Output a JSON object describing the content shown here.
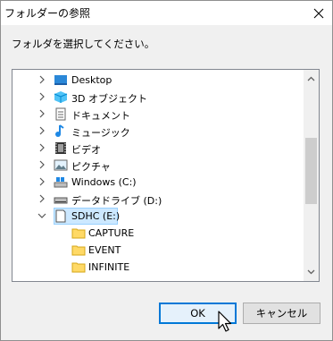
{
  "window": {
    "title": "フォルダーの参照"
  },
  "instruction": "フォルダを選択してください。",
  "tree": [
    {
      "label": "Desktop",
      "icon": "desktop-icon",
      "expander": "collapsed"
    },
    {
      "label": "3D オブジェクト",
      "icon": "3d-objects-icon",
      "expander": "collapsed"
    },
    {
      "label": "ドキュメント",
      "icon": "documents-icon",
      "expander": "collapsed"
    },
    {
      "label": "ミュージック",
      "icon": "music-icon",
      "expander": "collapsed"
    },
    {
      "label": "ビデオ",
      "icon": "videos-icon",
      "expander": "collapsed"
    },
    {
      "label": "ピクチャ",
      "icon": "pictures-icon",
      "expander": "collapsed"
    },
    {
      "label": "Windows (C:)",
      "icon": "windows-drive-icon",
      "expander": "collapsed"
    },
    {
      "label": "データドライブ (D:)",
      "icon": "drive-icon",
      "expander": "collapsed"
    },
    {
      "label": "SDHC (E:)",
      "icon": "sd-card-icon",
      "expander": "expanded",
      "selected": true
    },
    {
      "label": "CAPTURE",
      "icon": "folder-icon",
      "expander": "none"
    },
    {
      "label": "EVENT",
      "icon": "folder-icon",
      "expander": "none"
    },
    {
      "label": "INFINITE",
      "icon": "folder-icon",
      "expander": "none"
    }
  ],
  "buttons": {
    "ok": "OK",
    "cancel": "キャンセル"
  },
  "colors": {
    "selection": "#cce8ff",
    "accent": "#0078d7",
    "folder": "#ffd966"
  }
}
